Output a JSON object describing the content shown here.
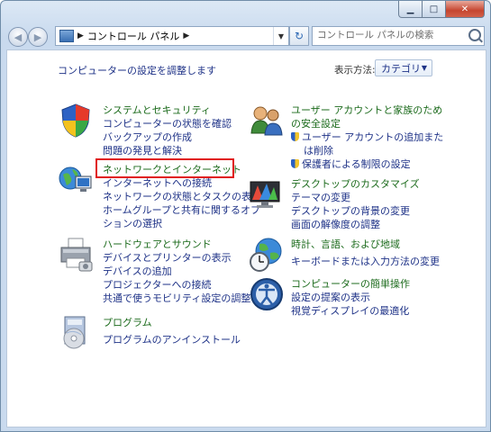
{
  "nav": {
    "breadcrumb": "コントロール パネル",
    "search_placeholder": "コントロール パネルの検索"
  },
  "header": {
    "heading": "コンピューターの設定を調整します",
    "view_by_label": "表示方法:",
    "view_by_value": "カテゴリ"
  },
  "categories": [
    {
      "title": "システムとセキュリティ",
      "links": [
        "コンピューターの状態を確認",
        "バックアップの作成",
        "問題の発見と解決"
      ],
      "icon": "shield-icon"
    },
    {
      "title": "ネットワークとインターネット",
      "links": [
        "インターネットへの接続",
        "ネットワークの状態とタスクの表示",
        "ホームグループと共有に関するオプ",
        "ションの選択"
      ],
      "icon": "network-icon"
    },
    {
      "title": "ハードウェアとサウンド",
      "links": [
        "デバイスとプリンターの表示",
        "デバイスの追加",
        "プロジェクターへの接続",
        "共通で使うモビリティ設定の調整"
      ],
      "icon": "printer-icon"
    },
    {
      "title": "プログラム",
      "links": [
        "プログラムのアンインストール"
      ],
      "icon": "programs-icon"
    },
    {
      "title": "ユーザー アカウントと家族のため",
      "title2": "の安全設定",
      "links": [
        "ユーザー アカウントの追加また",
        "は削除",
        "保護者による制限の設定"
      ],
      "icon": "users-icon"
    },
    {
      "title": "デスクトップのカスタマイズ",
      "links": [
        "テーマの変更",
        "デスクトップの背景の変更",
        "画面の解像度の調整"
      ],
      "icon": "desktop-icon"
    },
    {
      "title": "時計、言語、および地域",
      "links": [
        "キーボードまたは入力方法の変更"
      ],
      "icon": "globe-clock-icon"
    },
    {
      "title": "コンピューターの簡単操作",
      "links": [
        "設定の提案の表示",
        "視覚ディスプレイの最適化"
      ],
      "icon": "ease-of-access-icon"
    }
  ],
  "colors": {
    "link": "#1e3287",
    "category_title": "#1c6b1c",
    "highlight": "#e01818"
  }
}
